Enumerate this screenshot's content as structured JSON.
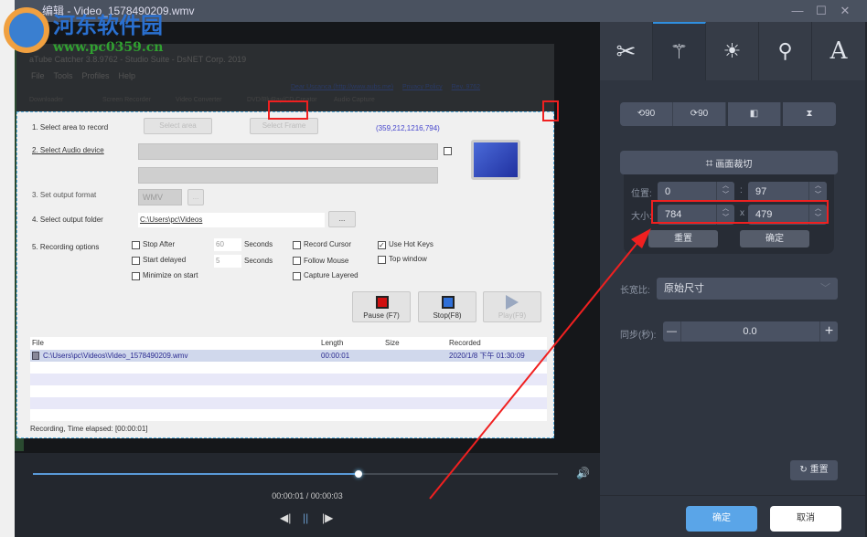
{
  "window": {
    "title": "编辑 - Video_1578490209.wmv",
    "min": "—",
    "max": "☐",
    "close": "✕"
  },
  "watermark": {
    "name": "河东软件园",
    "url": "www.pc0359.cn"
  },
  "atube": {
    "title": "aTube Catcher 3.8.9762 - Studio Suite - DsNET Corp. 2019",
    "menu": [
      "File",
      "Tools",
      "Profiles",
      "Help"
    ],
    "links": [
      "Dear Uscanca (http://www.aubs.me)",
      "Privacy Policy",
      "Rev. 9762"
    ],
    "tabs": [
      "Downloader",
      "Screen Recorder",
      "Video Converter",
      "DVD/BluRay/CD Creator",
      "Audio Capture"
    ],
    "step1": "1. Select area to record",
    "select_area": "Select area",
    "select_frame": "Select Frame",
    "coords": "(359,212,1216,794)",
    "step2": "2. Select Audio device",
    "step3": "3. Set output format",
    "format": "WMV",
    "more": "...",
    "step4": "4. Select output folder",
    "folder": "C:\\Users\\pc\\Videos",
    "browse": "...",
    "step5": "5. Recording options",
    "opts": {
      "stop_after": "Stop After",
      "stop_val": "60",
      "seconds1": "Seconds",
      "start_delayed": "Start delayed",
      "delay_val": "5",
      "seconds2": "Seconds",
      "minimize": "Minimize on start",
      "record_cursor": "Record Cursor",
      "follow_mouse": "Follow Mouse",
      "capture_layered": "Capture Layered",
      "hot_keys": "Use Hot Keys",
      "top_window": "Top window"
    },
    "pause": "Pause (F7)",
    "stop": "Stop(F8)",
    "play": "Play(F9)",
    "columns": [
      "File",
      "Length",
      "Size",
      "Recorded"
    ],
    "rows": [
      {
        "file": "C:\\Users\\pc\\Videos\\Video_1578490209.wmv",
        "length": "00:00:01",
        "size": "",
        "recorded": "2020/1/8 下午 01:30:09"
      }
    ],
    "status": "Recording, Time elapsed: [00:00:01]"
  },
  "player": {
    "time": "00:00:01 / 00:00:03",
    "progress": 0.62
  },
  "panel": {
    "tabs": [
      "cut",
      "effects",
      "adjust",
      "watermark",
      "text"
    ],
    "rotate": [
      "⟲90",
      "⟳90",
      "◧",
      "⧗"
    ],
    "crop_title": "画面裁切",
    "pos_label": "位置:",
    "pos_x": "0",
    "pos_sep": ":",
    "pos_y": "97",
    "size_label": "大小:",
    "size_w": "784",
    "size_sep": "x",
    "size_h": "479",
    "reset": "重置",
    "confirm": "确定",
    "ratio_label": "长宽比:",
    "ratio_value": "原始尺寸",
    "sync_label": "同步(秒):",
    "sync_value": "0.0",
    "minus": "—",
    "plus": "+",
    "reset_all": "重置",
    "ok": "确定",
    "cancel": "取消"
  },
  "colors": {
    "accent": "#2f8fe0",
    "annotation": "#f02020",
    "ok_button": "#5aa5e8"
  }
}
